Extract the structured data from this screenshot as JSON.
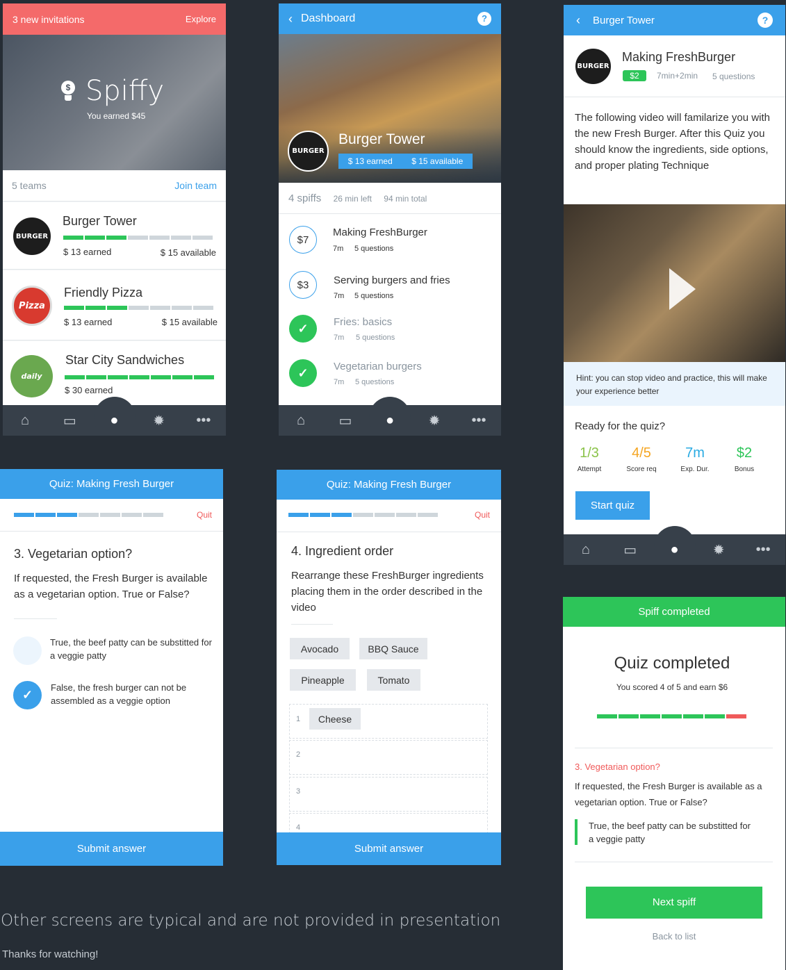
{
  "s1": {
    "topbar": {
      "invites": "3 new invitations",
      "explore": "Explore"
    },
    "brand": "Spiffy",
    "earned": "You earned $45",
    "teams_count": "5 teams",
    "join": "Join team",
    "teams": [
      {
        "name": "Burger Tower",
        "earned": "$ 13 earned",
        "available": "$ 15 available",
        "progress": 0.46
      },
      {
        "name": "Friendly Pizza",
        "earned": "$ 13 earned",
        "available": "$ 15 available",
        "progress": 0.42
      },
      {
        "name": "Star City Sandwiches",
        "earned": "$ 30 earned",
        "available": "",
        "progress": 1.0
      }
    ]
  },
  "s2": {
    "back": "Dashboard",
    "help": "?",
    "title": "Burger Tower",
    "earned": "$ 13 earned",
    "available": "$ 15 available",
    "stats": {
      "spiffs": "4 spiffs",
      "left": "26 min left",
      "total": "94 min total"
    },
    "spiffs": [
      {
        "badge": "$7",
        "title": "Making FreshBurger",
        "dur": "7m",
        "q": "5 questions",
        "done": false
      },
      {
        "badge": "$3",
        "title": "Serving burgers and fries",
        "dur": "7m",
        "q": "5 questions",
        "done": false
      },
      {
        "badge": "✓",
        "title": "Fries: basics",
        "dur": "7m",
        "q": "5 questions",
        "done": true
      },
      {
        "badge": "✓",
        "title": "Vegetarian burgers",
        "dur": "7m",
        "q": "5 questions",
        "done": true
      }
    ]
  },
  "s3": {
    "back": "Burger Tower",
    "help": "?",
    "title": "Making FreshBurger",
    "badge": "$2",
    "time": "7min+2min",
    "q": "5 questions",
    "desc": "The following video will familarize you with the new Fresh Burger. After this Quiz you should know the ingredients, side options, and proper plating Technique",
    "hint": "Hint: you can stop video and practice, this will make your experience better",
    "ready": "Ready for the quiz?",
    "stats": [
      {
        "val": "1/3",
        "lbl": "Attempt",
        "color": "#8bc34a"
      },
      {
        "val": "4/5",
        "lbl": "Score req",
        "color": "#f5a623"
      },
      {
        "val": "7m",
        "lbl": "Exp. Dur.",
        "color": "#29aae2"
      },
      {
        "val": "$2",
        "lbl": "Bonus",
        "color": "#2dc559"
      }
    ],
    "start": "Start quiz"
  },
  "s4": {
    "header": "Quiz: Making Fresh Burger",
    "quit": "Quit",
    "progress": {
      "done": 3,
      "total": 7
    },
    "question": "3. Vegetarian option?",
    "prompt": "If requested, the Fresh Burger is available as a vegetarian option. True or False?",
    "options": [
      {
        "text": "True, the beef patty can be substitted for a veggie patty",
        "selected": false
      },
      {
        "text": "False, the fresh burger can not be assembled as a veggie option",
        "selected": true
      }
    ],
    "submit": "Submit answer"
  },
  "s5": {
    "header": "Quiz: Making Fresh Burger",
    "quit": "Quit",
    "progress": {
      "done": 3,
      "total": 7
    },
    "question": "4. Ingredient order",
    "prompt": "Rearrange these FreshBurger ingredients placing them in the order described in the video",
    "chips": [
      "Avocado",
      "BBQ Sauce",
      "Pineapple",
      "Tomato"
    ],
    "slots": [
      {
        "n": "1",
        "item": "Cheese"
      },
      {
        "n": "2",
        "item": ""
      },
      {
        "n": "3",
        "item": ""
      },
      {
        "n": "4",
        "item": ""
      }
    ],
    "submit": "Submit answer"
  },
  "s6": {
    "header": "Spiff completed",
    "title": "Quiz completed",
    "score": "You scored 4 of 5 and earn $6",
    "progress": {
      "correct": 6,
      "wrong": 1
    },
    "review_q": "3. Vegetarian option?",
    "review_prompt": "If requested, the Fresh Burger is available as a vegetarian option. True or False?",
    "review_answer": "True, the beef patty can be substitted for a veggie patty",
    "next": "Next spiff",
    "back": "Back to list"
  },
  "footer": {
    "note": "Other screens are typical and are not provided in presentation",
    "thanks": "Thanks for watching!"
  },
  "colors": {
    "blue": "#3aa0ea",
    "green": "#2dc559",
    "red": "#f05a5a",
    "dark": "#262d35"
  },
  "icons": [
    "home-icon",
    "wallet-icon",
    "bulb-icon",
    "gear-icon",
    "more-icon",
    "play-icon",
    "check-icon",
    "chevron-left-icon",
    "help-icon"
  ]
}
